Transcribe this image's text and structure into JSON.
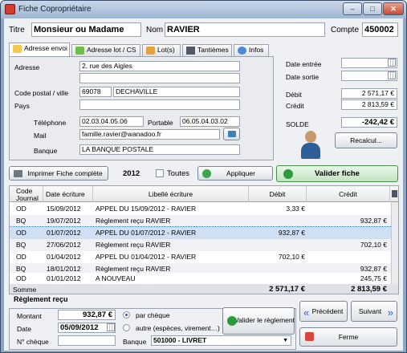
{
  "window": {
    "title": "Fiche Copropriétaire",
    "min": "–",
    "max": "□",
    "close": "✕"
  },
  "header": {
    "titre_label": "Titre",
    "titre_value": "Monsieur ou Madame",
    "nom_label": "Nom",
    "nom_value": "RAVIER",
    "compte_label": "Compte",
    "compte_value": "450002"
  },
  "tabs": [
    {
      "label": "Adresse envoi"
    },
    {
      "label": "Adresse lot / CS"
    },
    {
      "label": "Lot(s)"
    },
    {
      "label": "Tantièmes"
    },
    {
      "label": "Infos"
    }
  ],
  "address": {
    "adresse_label": "Adresse",
    "adresse1": "2, rue des Aigles",
    "adresse2": "",
    "cp_label": "Code postal / ville",
    "cp": "69078",
    "ville": "DECHAVILLE",
    "pays_label": "Pays",
    "pays": "",
    "tel_label": "Téléphone",
    "tel": "02.03.04.05.06",
    "portable_label": "Portable",
    "portable": "06.05.04.03.02",
    "mail_label": "Mail",
    "mail": "famille.ravier@wanadoo.fr",
    "banque_label": "Banque",
    "banque": "LA BANQUE POSTALE"
  },
  "summary": {
    "date_entree_label": "Date entrée",
    "date_entree": "",
    "date_sortie_label": "Date sortie",
    "date_sortie": "",
    "debit_label": "Débit",
    "debit": "2 571,17 €",
    "credit_label": "Crédit",
    "credit": "2 813,59 €",
    "solde_label": "SOLDE",
    "solde": "-242,42 €",
    "recalcul": "Recalcul..."
  },
  "toolbar": {
    "print": "Imprimer Fiche complète",
    "year": "2012",
    "toutes": "Toutes",
    "appliquer": "Appliquer",
    "valider": "Valider fiche"
  },
  "grid": {
    "headers": {
      "code": "Code Journal",
      "date": "Date écriture",
      "libelle": "Libellé écriture",
      "debit": "Débit",
      "credit": "Crédit"
    },
    "rows": [
      {
        "code": "OD",
        "date": "15/09/2012",
        "libelle": "APPEL DU 15/09/2012 - RAVIER",
        "debit": "3,33 €",
        "credit": ""
      },
      {
        "code": "BQ",
        "date": "19/07/2012",
        "libelle": "Règlement reçu RAVIER",
        "debit": "",
        "credit": "932,87 €"
      },
      {
        "code": "OD",
        "date": "01/07/2012",
        "libelle": "APPEL DU 01/07/2012 - RAVIER",
        "debit": "932,87 €",
        "credit": ""
      },
      {
        "code": "BQ",
        "date": "27/06/2012",
        "libelle": "Règlement reçu RAVIER",
        "debit": "",
        "credit": "702,10 €"
      },
      {
        "code": "OD",
        "date": "01/04/2012",
        "libelle": "APPEL DU 01/04/2012 - RAVIER",
        "debit": "702,10 €",
        "credit": ""
      },
      {
        "code": "BQ",
        "date": "18/01/2012",
        "libelle": "Règlement reçu RAVIER",
        "debit": "",
        "credit": "932,87 €"
      },
      {
        "code": "OD",
        "date": "01/01/2012",
        "libelle": "A NOUVEAU",
        "debit": "",
        "credit": "245,75 €"
      }
    ],
    "sum_label": "Somme",
    "sum_debit": "2 571,17 €",
    "sum_credit": "2 813,59 €"
  },
  "reglement": {
    "title": "Règlement reçu",
    "montant_label": "Montant",
    "montant": "932,87 €",
    "date_label": "Date",
    "date": "05/09/2012",
    "cheque_label": "N° chèque",
    "cheque": "",
    "par_cheque": "par chèque",
    "autre": "autre (espèces, virement…)",
    "banque_label": "Banque",
    "banque": "501000 - LIVRET",
    "valider": "Valider le règlement"
  },
  "nav": {
    "precedent": "Précédent",
    "suivant": "Suivant",
    "fermer": "Ferme"
  }
}
